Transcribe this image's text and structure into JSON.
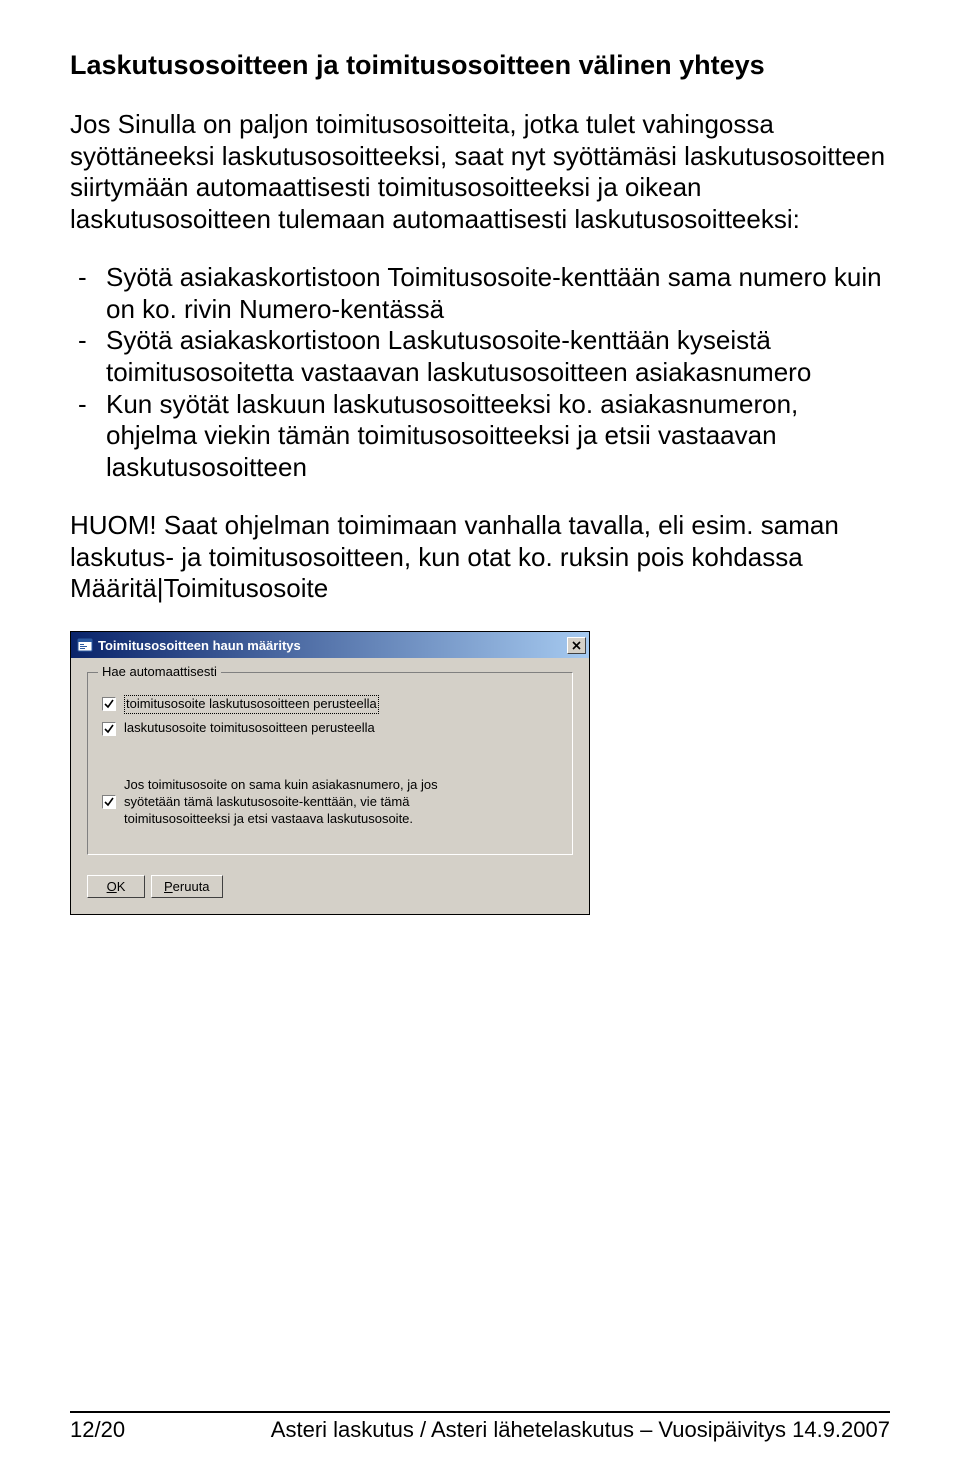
{
  "heading": "Laskutusosoitteen ja toimitusosoitteen välinen yhteys",
  "para1": "Jos Sinulla on paljon toimitusosoitteita, jotka tulet vahingossa syöttäneeksi laskutusosoitteeksi, saat nyt syöttämäsi laskutusosoitteen siirtymään automaattisesti toimitusosoitteeksi ja oikean laskutusosoitteen tulemaan automaattisesti laskutusosoitteeksi:",
  "bullets": [
    "Syötä asiakaskortistoon Toimitusosoite-kenttään sama numero kuin on ko. rivin Numero-kentässä",
    "Syötä asiakaskortistoon Laskutusosoite-kenttään kyseistä toimitusosoitetta vastaavan laskutusosoitteen asiakasnumero",
    "Kun syötät laskuun laskutusosoitteeksi ko. asiakasnumeron, ohjelma viekin tämän toimitusosoitteeksi ja etsii vastaavan laskutusosoitteen"
  ],
  "para2": "HUOM! Saat ohjelman toimimaan vanhalla tavalla, eli esim. saman laskutus- ja toimitusosoitteen, kun otat ko. ruksin pois kohdassa Määritä|Toimitusosoite",
  "dialog": {
    "title": "Toimitusosoitteen haun määritys",
    "group_legend": "Hae automaattisesti",
    "chk1": "toimitusosoite laskutusosoitteen perusteella",
    "chk2": "laskutusosoite toimitusosoitteen perusteella",
    "chk3": "Jos toimitusosoite on sama kuin asiakasnumero, ja jos syötetään tämä laskutusosoite-kenttään, vie tämä toimitusosoitteeksi ja etsi vastaava laskutusosoite.",
    "ok": "OK",
    "cancel": "Peruuta"
  },
  "footer": {
    "left": "12/20",
    "right": "Asteri laskutus / Asteri lähetelaskutus – Vuosipäivitys 14.9.2007"
  }
}
